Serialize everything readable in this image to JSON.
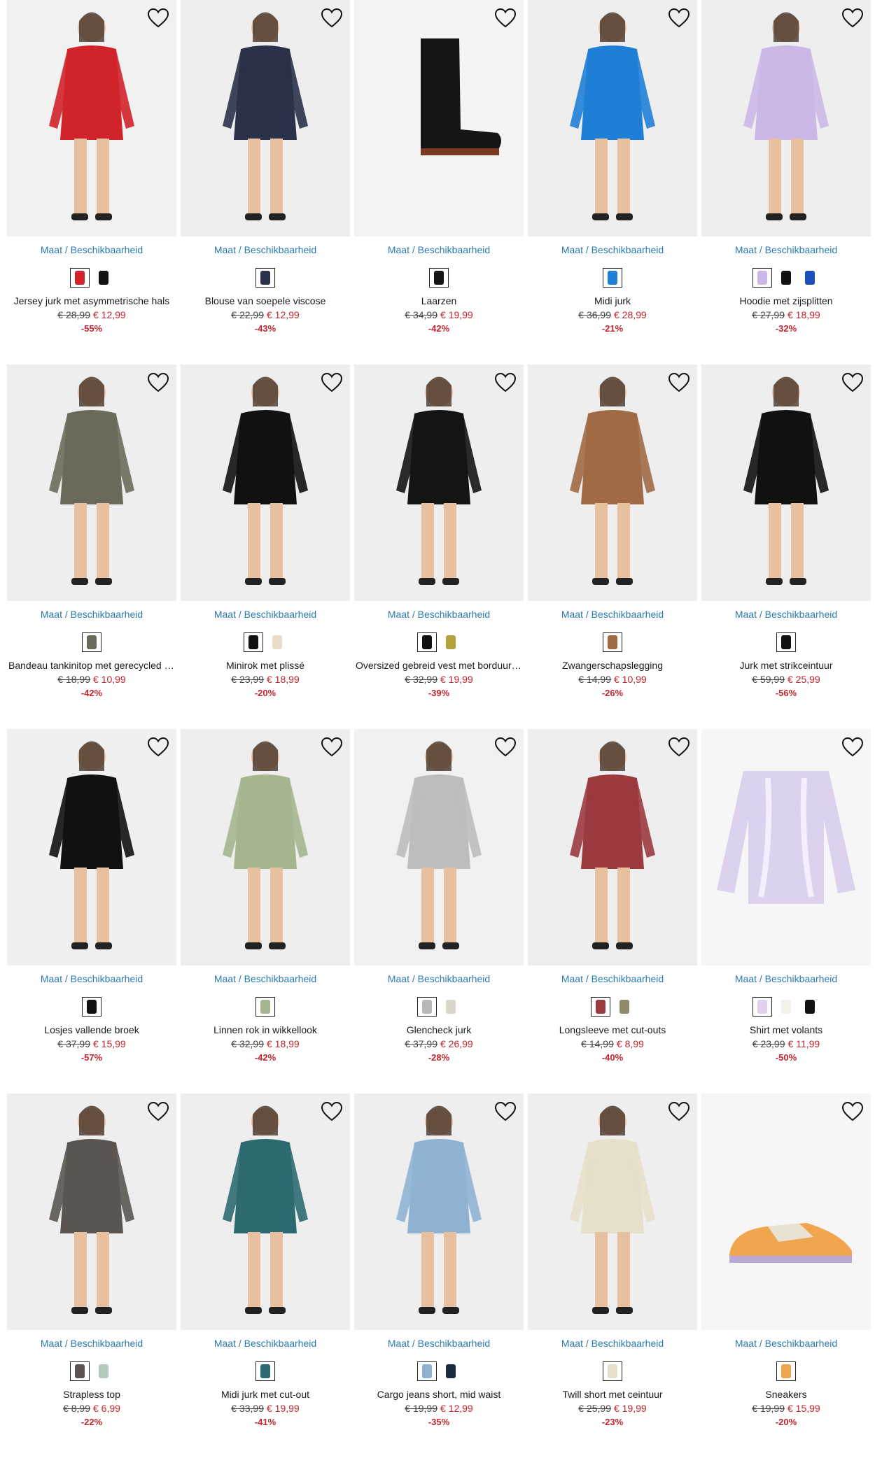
{
  "colors": {
    "link": "#2a7ab0",
    "sale": "#c0262d",
    "photo_bg": "#eeeeee"
  },
  "products": [
    {
      "avail": "Maat / Beschikbaarheid",
      "name": "Jersey jurk met asymmetrische hals",
      "old": "€ 28,99",
      "new": "€ 12,99",
      "disc": "-55%",
      "swatches": [
        "#d0232a",
        "#111111"
      ],
      "icon": "red-dress-photo",
      "bg": "#f1f1f1",
      "fg": "#d0232a"
    },
    {
      "avail": "Maat / Beschikbaarheid",
      "name": "Blouse van soepele viscose",
      "old": "€ 22,99",
      "new": "€ 12,99",
      "disc": "-43%",
      "swatches": [
        "#2a3148"
      ],
      "icon": "plaid-blouse-photo",
      "bg": "#eeeeee",
      "fg": "#2a3148"
    },
    {
      "avail": "Maat / Beschikbaarheid",
      "name": "Laarzen",
      "old": "€ 34,99",
      "new": "€ 19,99",
      "disc": "-42%",
      "swatches": [
        "#151515"
      ],
      "icon": "boot-photo",
      "bg": "#f4f4f4",
      "fg": "#151515"
    },
    {
      "avail": "Maat / Beschikbaarheid",
      "name": "Midi jurk",
      "old": "€ 36,99",
      "new": "€ 28,99",
      "disc": "-21%",
      "swatches": [
        "#1f7fd6"
      ],
      "icon": "blue-dress-photo",
      "bg": "#eeeeee",
      "fg": "#1f7fd6"
    },
    {
      "avail": "Maat / Beschikbaarheid",
      "name": "Hoodie met zijsplitten",
      "old": "€ 27,99",
      "new": "€ 18,99",
      "disc": "-32%",
      "swatches": [
        "#cbb8e6",
        "#111111",
        "#1d4fb8"
      ],
      "icon": "hoodie-photo",
      "bg": "#eeeeee",
      "fg": "#cbb8e6"
    },
    {
      "avail": "Maat / Beschikbaarheid",
      "name": "Bandeau tankinitop met gerecycled polyamide",
      "old": "€ 18,99",
      "new": "€ 10,99",
      "disc": "-42%",
      "swatches": [
        "#6b6a5a"
      ],
      "icon": "tankini-photo",
      "bg": "#eeeeee",
      "fg": "#6b6a5a"
    },
    {
      "avail": "Maat / Beschikbaarheid",
      "name": "Minirok met plissé",
      "old": "€ 23,99",
      "new": "€ 18,99",
      "disc": "-20%",
      "swatches": [
        "#111111",
        "#e8dcc8"
      ],
      "icon": "skirt-photo",
      "bg": "#eeeeee",
      "fg": "#111111"
    },
    {
      "avail": "Maat / Beschikbaarheid",
      "name": "Oversized gebreid vest met borduursel",
      "old": "€ 32,99",
      "new": "€ 19,99",
      "disc": "-39%",
      "swatches": [
        "#111111",
        "#b3a13a"
      ],
      "icon": "cardigan-photo",
      "bg": "#eeeeee",
      "fg": "#141414"
    },
    {
      "avail": "Maat / Beschikbaarheid",
      "name": "Zwangerschapslegging",
      "old": "€ 14,99",
      "new": "€ 10,99",
      "disc": "-26%",
      "swatches": [
        "#a06a45"
      ],
      "icon": "legging-photo",
      "bg": "#eeeeee",
      "fg": "#a06a45"
    },
    {
      "avail": "Maat / Beschikbaarheid",
      "name": "Jurk met strikceintuur",
      "old": "€ 59,99",
      "new": "€ 25,99",
      "disc": "-56%",
      "swatches": [
        "#111111"
      ],
      "icon": "dotted-dress-photo",
      "bg": "#eeeeee",
      "fg": "#111111"
    },
    {
      "avail": "Maat / Beschikbaarheid",
      "name": "Losjes vallende broek",
      "old": "€ 37,99",
      "new": "€ 15,99",
      "disc": "-57%",
      "swatches": [
        "#111111"
      ],
      "icon": "trousers-photo",
      "bg": "#f0f0f0",
      "fg": "#111111"
    },
    {
      "avail": "Maat / Beschikbaarheid",
      "name": "Linnen rok in wikkellook",
      "old": "€ 32,99",
      "new": "€ 18,99",
      "disc": "-42%",
      "swatches": [
        "#a5b68e"
      ],
      "icon": "linen-skirt-photo",
      "bg": "#eeeeee",
      "fg": "#a5b68e"
    },
    {
      "avail": "Maat / Beschikbaarheid",
      "name": "Glencheck jurk",
      "old": "€ 37,99",
      "new": "€ 26,99",
      "disc": "-28%",
      "swatches": [
        "#b8b8b8",
        "#d9d6cc"
      ],
      "icon": "check-dress-photo",
      "bg": "#f1f1f1",
      "fg": "#bdbdbd"
    },
    {
      "avail": "Maat / Beschikbaarheid",
      "name": "Longsleeve met cut-outs",
      "old": "€ 14,99",
      "new": "€ 8,99",
      "disc": "-40%",
      "swatches": [
        "#9b3a3f",
        "#8f8a6a"
      ],
      "icon": "longsleeve-photo",
      "bg": "#eeeeee",
      "fg": "#9b3a3f"
    },
    {
      "avail": "Maat / Beschikbaarheid",
      "name": "Shirt met volants",
      "old": "€ 23,99",
      "new": "€ 11,99",
      "disc": "-50%",
      "swatches": [
        "#ddd2ee",
        "#f4f1ea",
        "#111111"
      ],
      "icon": "ruffle-shirt-photo",
      "bg": "#f6f6f6",
      "fg": "#ddd2ee"
    },
    {
      "avail": "Maat / Beschikbaarheid",
      "name": "Strapless top",
      "old": "€ 8,99",
      "new": "€ 6,99",
      "disc": "-22%",
      "swatches": [
        "#5a5550",
        "#b5c9bc"
      ],
      "icon": "strapless-top-photo",
      "bg": "#eeeeee",
      "fg": "#5a5550"
    },
    {
      "avail": "Maat / Beschikbaarheid",
      "name": "Midi jurk met cut-out",
      "old": "€ 33,99",
      "new": "€ 19,99",
      "disc": "-41%",
      "swatches": [
        "#2c6a70"
      ],
      "icon": "teal-dress-photo",
      "bg": "#eeeeee",
      "fg": "#2c6a70"
    },
    {
      "avail": "Maat / Beschikbaarheid",
      "name": "Cargo jeans short, mid waist",
      "old": "€ 19,99",
      "new": "€ 12,99",
      "disc": "-35%",
      "swatches": [
        "#8fb2d3",
        "#1c2a44"
      ],
      "icon": "denim-short-photo",
      "bg": "#eeeeee",
      "fg": "#8fb2d3"
    },
    {
      "avail": "Maat / Beschikbaarheid",
      "name": "Twill short met ceintuur",
      "old": "€ 25,99",
      "new": "€ 19,99",
      "disc": "-23%",
      "swatches": [
        "#e6dfc9"
      ],
      "icon": "twill-short-photo",
      "bg": "#eeeeee",
      "fg": "#e6dfc9"
    },
    {
      "avail": "Maat / Beschikbaarheid",
      "name": "Sneakers",
      "old": "€ 19,99",
      "new": "€ 15,99",
      "disc": "-20%",
      "swatches": [
        "#f1a54e"
      ],
      "icon": "sneaker-photo",
      "bg": "#f6f6f6",
      "fg": "#f1a54e"
    }
  ]
}
